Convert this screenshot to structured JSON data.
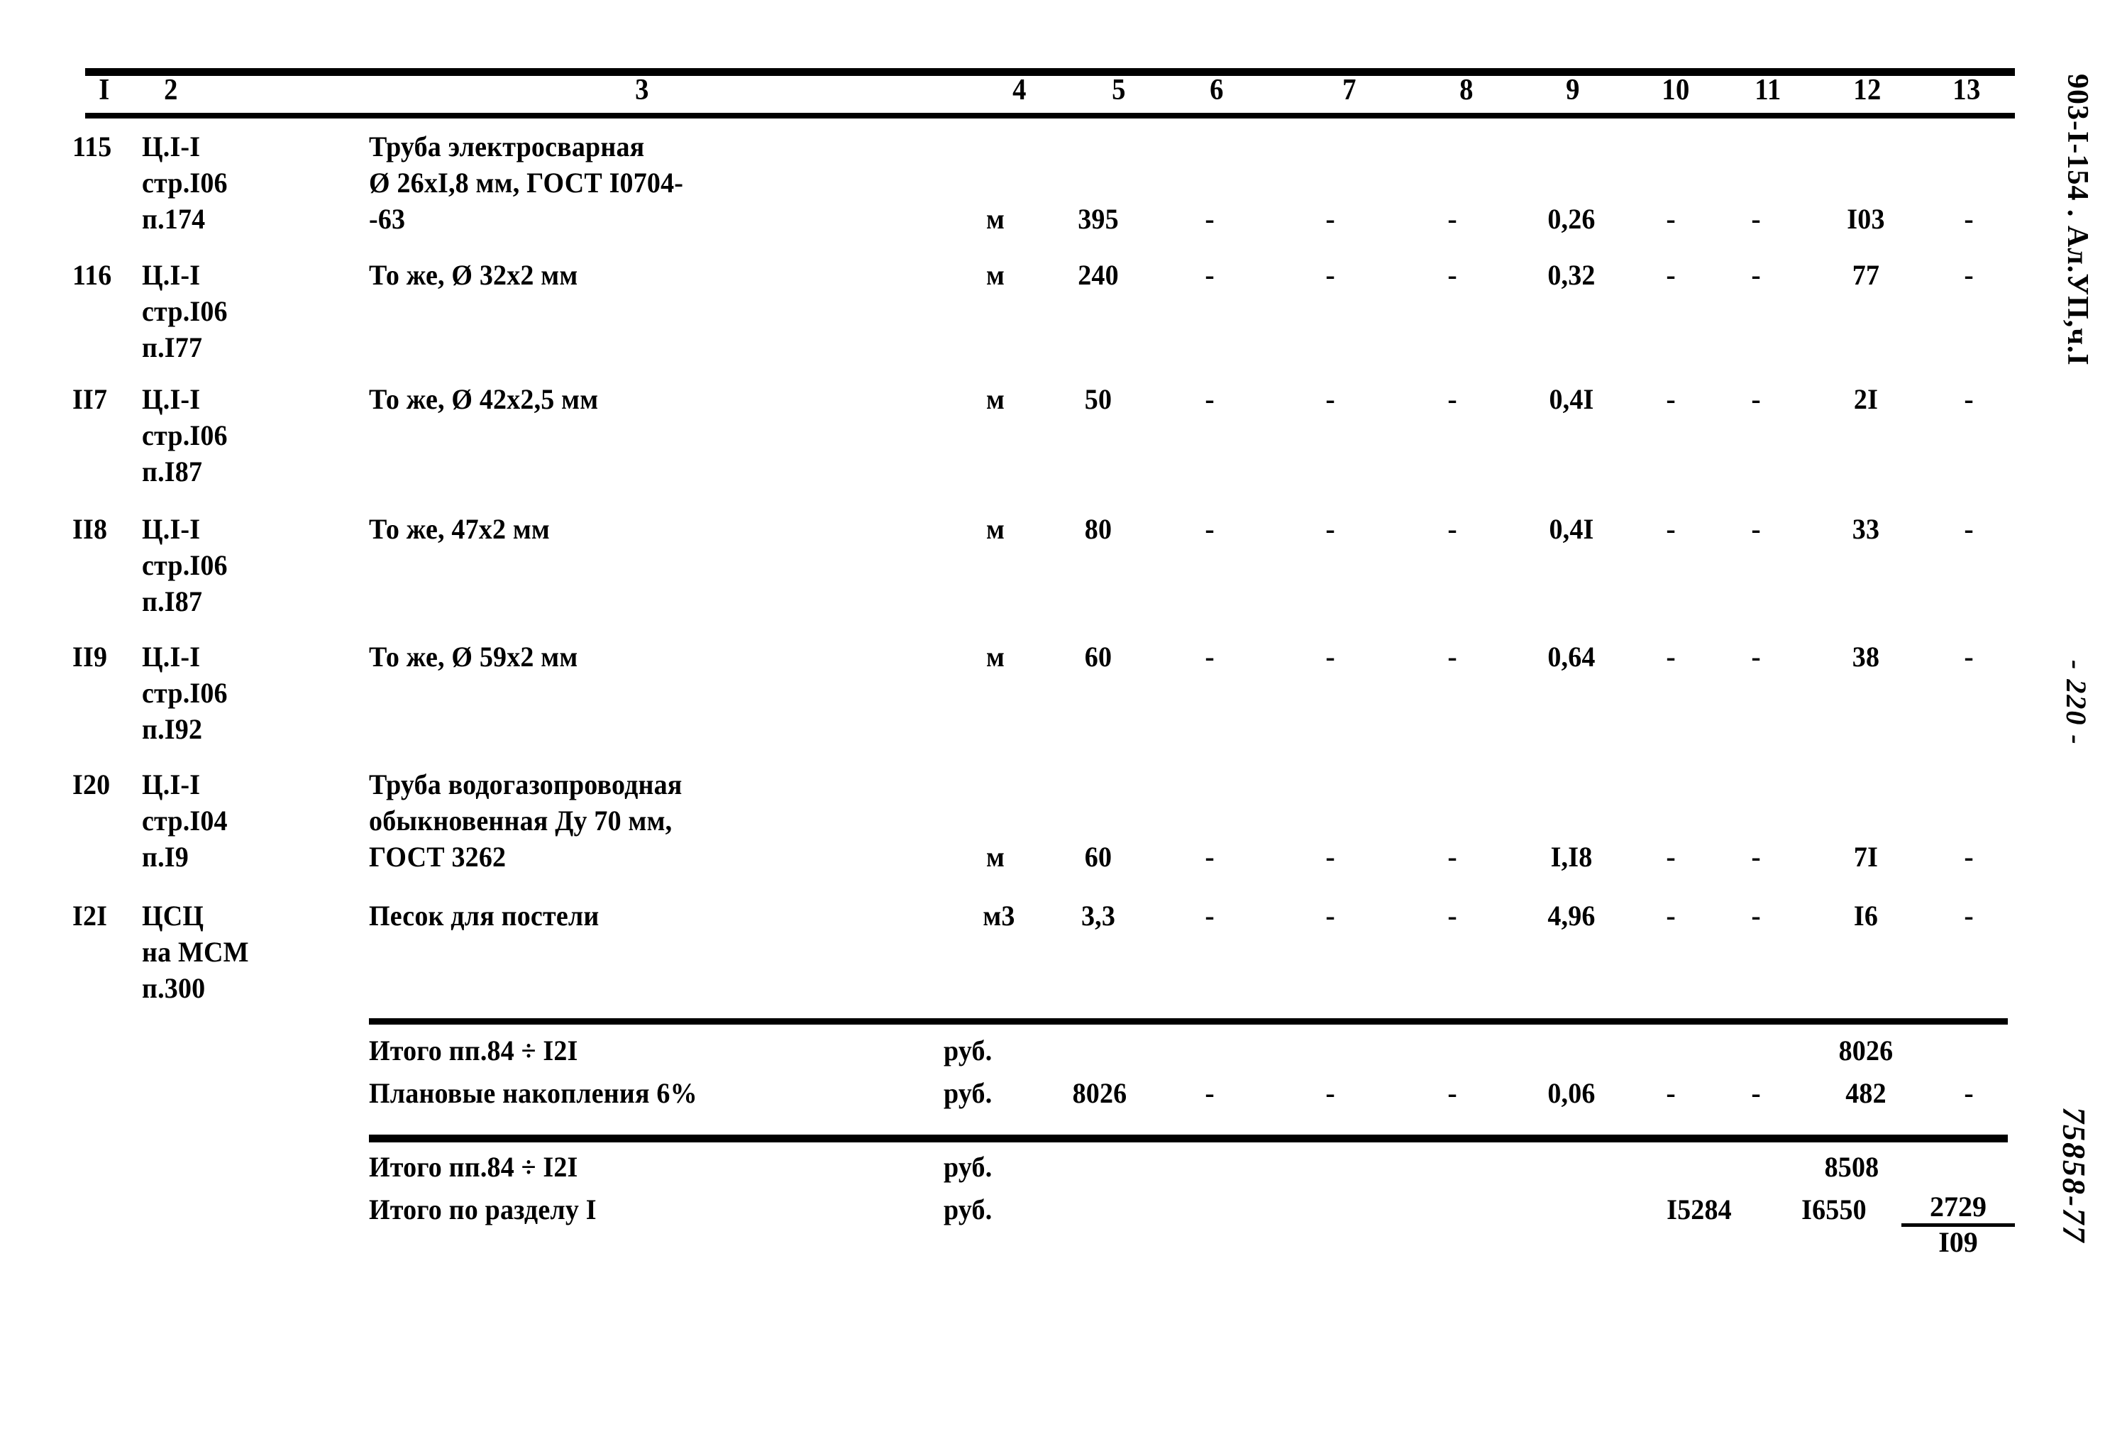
{
  "document": {
    "margin_code": "903-I-154 . Ал.УП,ч.I",
    "page_number": "- 220 -",
    "order_stamp": "75858-77"
  },
  "table": {
    "column_headers": [
      "I",
      "2",
      "3",
      "4",
      "5",
      "6",
      "7",
      "8",
      "9",
      "10",
      "11",
      "12",
      "13"
    ],
    "dash": "-",
    "rows": [
      {
        "no": "115",
        "ref": "Ц.I-I\nстр.I06\nп.174",
        "name": "Труба электросварная\nØ 26xI,8 мм, ГОСТ I0704-\n-63",
        "unit": "м",
        "qty": "395",
        "c6": "-",
        "c7": "-",
        "c8": "-",
        "c9": "0,26",
        "c10": "-",
        "c11": "-",
        "c12": "I03",
        "c13": "-"
      },
      {
        "no": "116",
        "ref": "Ц.I-I\nстр.I06\nп.I77",
        "name": "То же, Ø 32x2 мм",
        "unit": "м",
        "qty": "240",
        "c6": "-",
        "c7": "-",
        "c8": "-",
        "c9": "0,32",
        "c10": "-",
        "c11": "-",
        "c12": "77",
        "c13": "-"
      },
      {
        "no": "II7",
        "ref": "Ц.I-I\nстр.I06\nп.I87",
        "name": "То же, Ø 42x2,5 мм",
        "unit": "м",
        "qty": "50",
        "c6": "-",
        "c7": "-",
        "c8": "-",
        "c9": "0,4I",
        "c10": "-",
        "c11": "-",
        "c12": "2I",
        "c13": "-"
      },
      {
        "no": "II8",
        "ref": "Ц.I-I\nстр.I06\nп.I87",
        "name": "То же, 47x2 мм",
        "unit": "м",
        "qty": "80",
        "c6": "-",
        "c7": "-",
        "c8": "-",
        "c9": "0,4I",
        "c10": "-",
        "c11": "-",
        "c12": "33",
        "c13": "-"
      },
      {
        "no": "II9",
        "ref": "Ц.I-I\nстр.I06\nп.I92",
        "name": "То же, Ø 59x2 мм",
        "unit": "м",
        "qty": "60",
        "c6": "-",
        "c7": "-",
        "c8": "-",
        "c9": "0,64",
        "c10": "-",
        "c11": "-",
        "c12": "38",
        "c13": "-"
      },
      {
        "no": "I20",
        "ref": "Ц.I-I\nстр.I04\nп.I9",
        "name": "Труба водогазопроводная\nобыкновенная Ду 70 мм,\nГОСТ 3262",
        "unit": "м",
        "qty": "60",
        "c6": "-",
        "c7": "-",
        "c8": "-",
        "c9": "I,I8",
        "c10": "-",
        "c11": "-",
        "c12": "7I",
        "c13": "-"
      },
      {
        "no": "I2I",
        "ref": "ЦСЦ\nна МСМ\nп.300",
        "name": "Песок для постели",
        "unit": "м3",
        "qty": "3,3",
        "c6": "-",
        "c7": "-",
        "c8": "-",
        "c9": "4,96",
        "c10": "-",
        "c11": "-",
        "c12": "I6",
        "c13": "-"
      }
    ],
    "totals": [
      {
        "label": "Итого пп.84 ÷ I2I",
        "unit": "руб.",
        "qty": "",
        "c6": "",
        "c7": "",
        "c8": "",
        "c9": "",
        "c10": "",
        "c11": "",
        "c12": "8026",
        "c13": ""
      },
      {
        "label": "Плановые накопления 6%",
        "unit": "руб.",
        "qty": "8026",
        "c6": "-",
        "c7": "-",
        "c8": "-",
        "c9": "0,06",
        "c10": "-",
        "c11": "-",
        "c12": "482",
        "c13": "-"
      },
      {
        "label": "Итого пп.84 ÷ I2I",
        "unit": "руб.",
        "qty": "",
        "c6": "",
        "c7": "",
        "c8": "",
        "c9": "",
        "c10": "",
        "c11": "",
        "c12": "8508",
        "c13": ""
      },
      {
        "label": "Итого по разделу I",
        "unit": "руб.",
        "qty": "",
        "c6": "",
        "c7": "",
        "c8": "",
        "c9": "",
        "c10": "",
        "c11": "I5284",
        "c12": "I6550",
        "c13_num": "2729",
        "c13_den": "I09"
      }
    ]
  }
}
